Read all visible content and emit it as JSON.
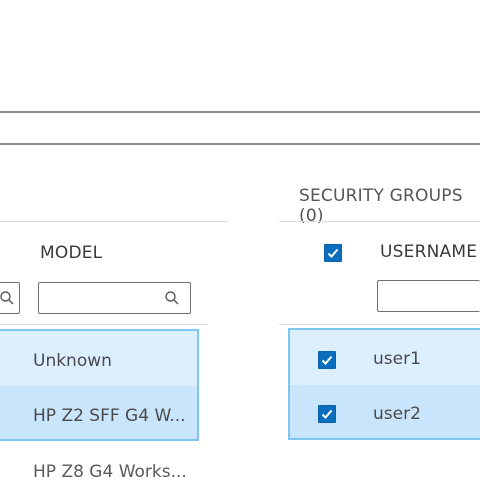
{
  "security_groups": {
    "title": "SECURITY GROUPS (0)"
  },
  "devices_table": {
    "model_header": "MODEL",
    "rows": [
      {
        "model": "Unknown",
        "selected": true
      },
      {
        "model": "HP Z2 SFF G4 W...",
        "selected": true
      },
      {
        "model": "HP Z8 G4 Works...",
        "selected": false
      }
    ]
  },
  "users_table": {
    "username_header": "USERNAME",
    "select_all_checked": true,
    "rows": [
      {
        "username": "user1",
        "checked": true
      },
      {
        "username": "user2",
        "checked": true
      }
    ]
  },
  "colors": {
    "accent": "#0a6ebd",
    "selection_fill": "#dcefff",
    "selection_border": "#7ec5f2"
  },
  "icons": {
    "search": "search-icon",
    "checkbox_check": "checkmark-icon"
  }
}
